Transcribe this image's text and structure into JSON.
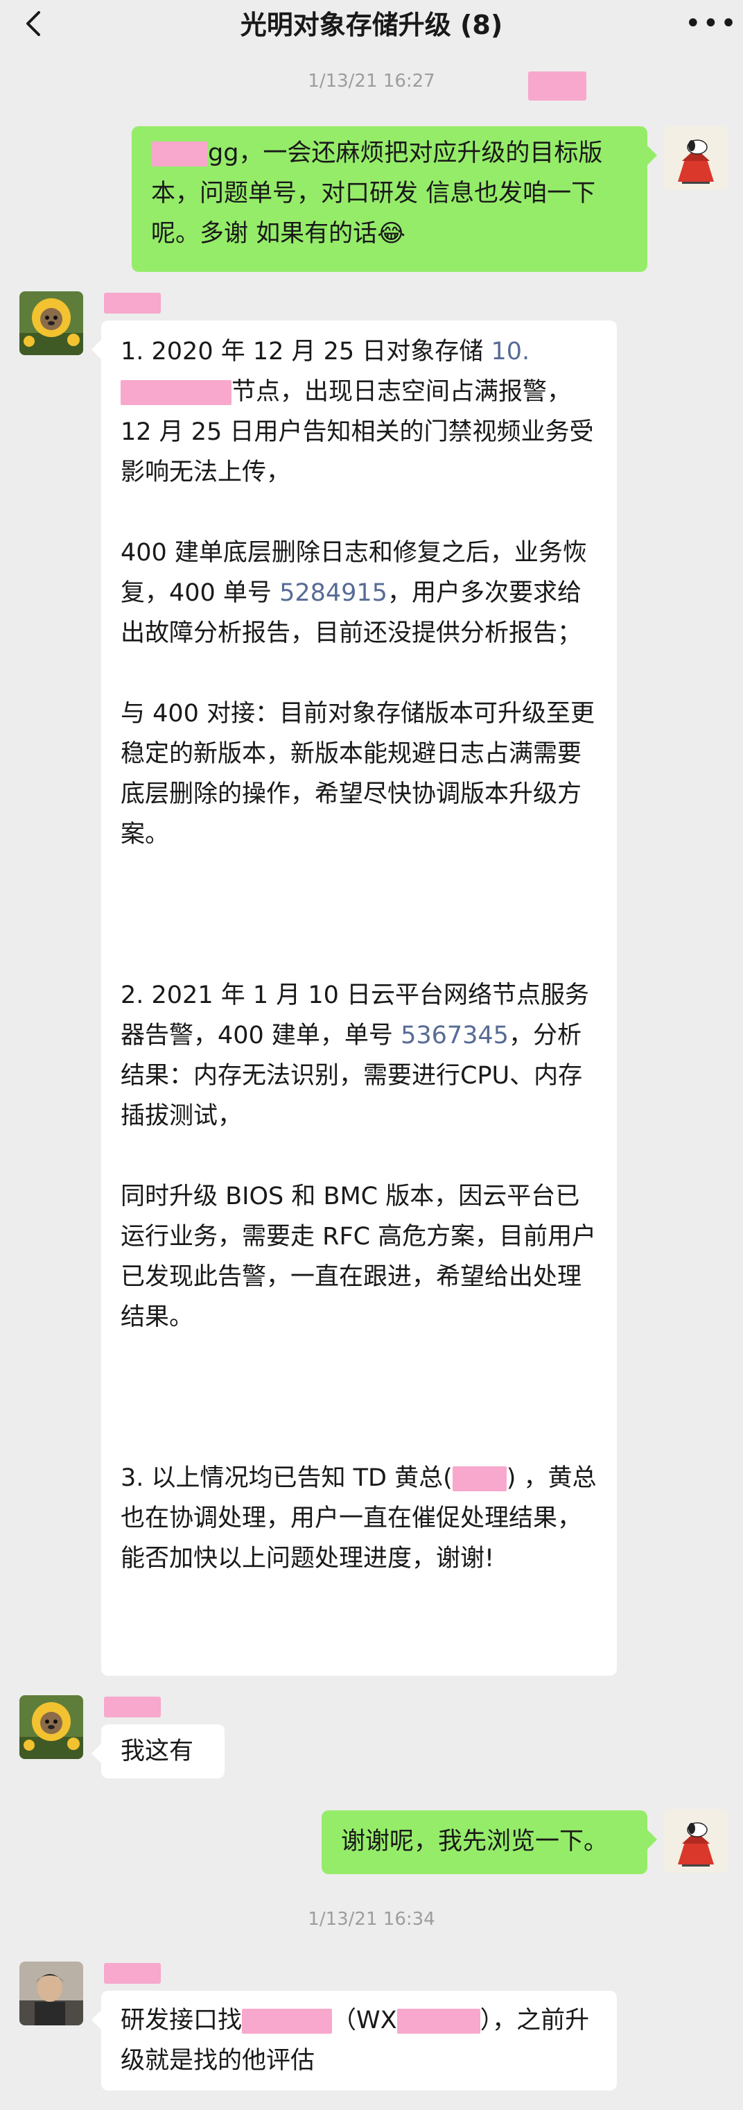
{
  "header": {
    "title": "光明对象存储升级 (8)",
    "back_label": "‹",
    "more_label": "⋯"
  },
  "timestamps": [
    "1/13/21 16:27",
    "1/13/21 16:34"
  ],
  "messages": {
    "m1": {
      "text_after_mask": "gg，一会还麻烦把对应升级的目标版本，问题单号，对口研发 信息也发咱一下呢。多谢 如果有的话😂"
    },
    "m2": {
      "p1_prefix": "1. 2020 年 12 月 25 日对象存储",
      "p1_ip_prefix": "10.",
      "p1_rest": "节点，出现日志空间占满报警，12 月 25 日用户告知相关的门禁视频业务受影响无法上传，",
      "p2_prefix": "400 建单底层删除日志和修复之后，业务恢复，400 单号 ",
      "p2_link": "5284915",
      "p2_suffix": "，用户多次要求给出故障分析报告，目前还没提供分析报告；",
      "p3": "与 400 对接：目前对象存储版本可升级至更稳定的新版本，新版本能规避日志占满需要底层删除的操作，希望尽快协调版本升级方案。",
      "p4_prefix": "2. 2021 年 1 月 10 日云平台网络节点服务器告警，400 建单，单号 ",
      "p4_link": "5367345",
      "p4_suffix": "，分析结果：内存无法识别，需要进行CPU、内存插拔测试，",
      "p5": "同时升级 BIOS 和 BMC 版本，因云平台已运行业务，需要走 RFC 高危方案，目前用户已发现此告警，一直在跟进，希望给出处理结果。",
      "p6_prefix": "3. 以上情况均已告知 TD 黄总(",
      "p6_suffix": ") ，黄总也在协调处理，用户一直在催促处理结果，能否加快以上问题处理进度，谢谢!"
    },
    "m3": {
      "text": "我这有"
    },
    "m4": {
      "text": "谢谢呢，我先浏览一下。"
    },
    "m5": {
      "prefix": "研发接口找",
      "mid": "（WX",
      "suffix": "），之前升级就是找的他评估"
    }
  },
  "colors": {
    "background": "#ededed",
    "green_bubble": "#95ec69",
    "white_bubble": "#ffffff",
    "link": "#576b95",
    "redaction": "#f7a8cc"
  },
  "icons": [
    "back-arrow-icon",
    "more-dots-icon",
    "avatar-sunflower-dog",
    "avatar-snoopy",
    "avatar-person"
  ]
}
